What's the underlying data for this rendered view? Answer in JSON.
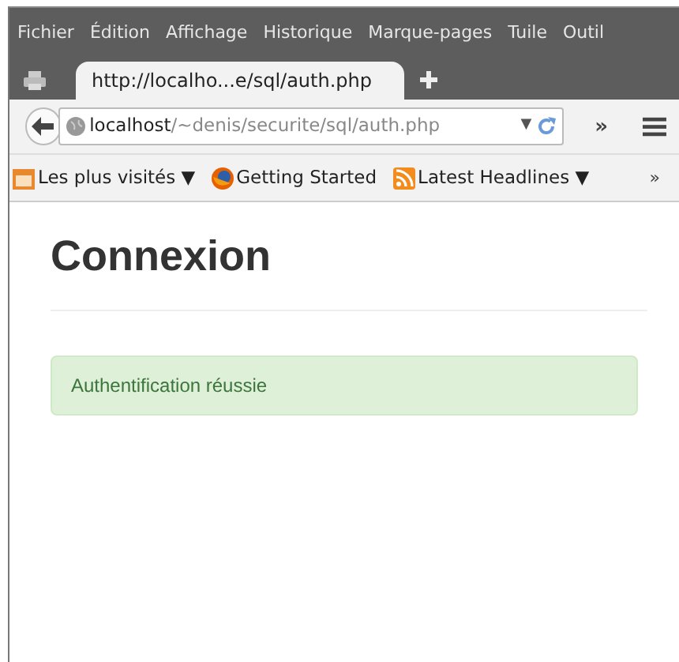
{
  "menu_bar": {
    "items": [
      "Fichier",
      "Édition",
      "Affichage",
      "Historique",
      "Marque-pages",
      "Tuile",
      "Outil"
    ]
  },
  "tabs": [
    {
      "title": "http://localho...e/sql/auth.php",
      "selected": true
    }
  ],
  "address_bar": {
    "host": "localhost",
    "path": "/~denis/securite/sql/auth.php",
    "dropdown": "▼",
    "overflow": "»"
  },
  "bookmarks": [
    {
      "kind": "folder",
      "label": "Les plus visités",
      "dropdown": "▼"
    },
    {
      "kind": "firefox",
      "label": "Getting Started"
    },
    {
      "kind": "rss",
      "label": "Latest Headlines",
      "dropdown": "▼"
    }
  ],
  "bookmarks_overflow": "»",
  "page": {
    "heading": "Connexion",
    "alert": "Authentification réussie"
  }
}
